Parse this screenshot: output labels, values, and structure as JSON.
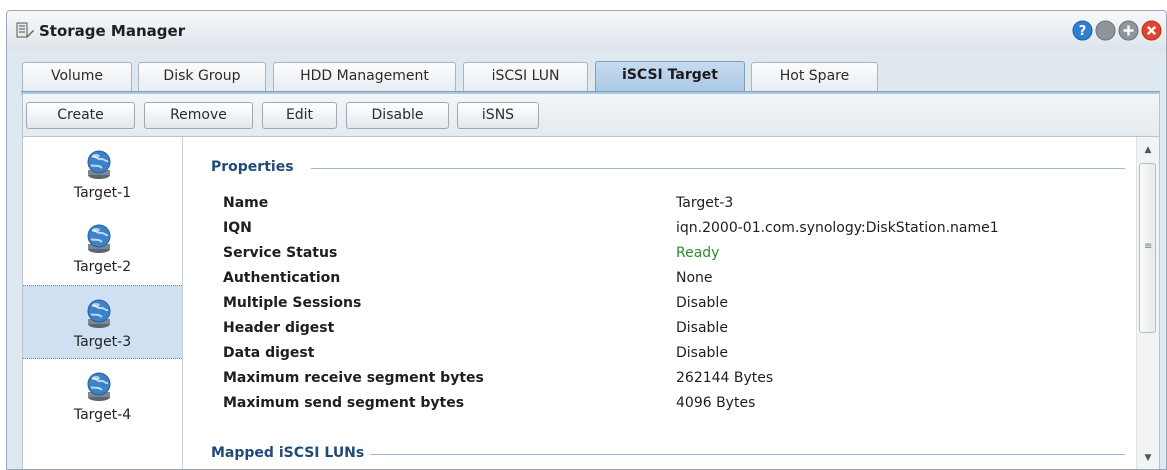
{
  "window": {
    "title": "Storage Manager",
    "app_icon": "storage-manager-icon",
    "controls": [
      "help-icon",
      "minimize-icon",
      "maximize-icon",
      "close-icon"
    ]
  },
  "tabs": [
    {
      "label": "Volume",
      "active": false
    },
    {
      "label": "Disk Group",
      "active": false
    },
    {
      "label": "HDD Management",
      "active": false
    },
    {
      "label": "iSCSI LUN",
      "active": false
    },
    {
      "label": "iSCSI Target",
      "active": true
    },
    {
      "label": "Hot Spare",
      "active": false
    }
  ],
  "toolbar": {
    "create": "Create",
    "remove": "Remove",
    "edit": "Edit",
    "disable": "Disable",
    "isns": "iSNS"
  },
  "targets": [
    {
      "label": "Target-1",
      "icon": "globe-disk-icon",
      "selected": false
    },
    {
      "label": "Target-2",
      "icon": "globe-disk-icon",
      "selected": false
    },
    {
      "label": "Target-3",
      "icon": "globe-disk-icon",
      "selected": true
    },
    {
      "label": "Target-4",
      "icon": "globe-disk-icon",
      "selected": false
    }
  ],
  "properties": {
    "heading": "Properties",
    "rows": [
      {
        "label": "Name",
        "value": "Target-3"
      },
      {
        "label": "IQN",
        "value": "iqn.2000-01.com.synology:DiskStation.name1"
      },
      {
        "label": "Service Status",
        "value": "Ready"
      },
      {
        "label": "Authentication",
        "value": "None"
      },
      {
        "label": "Multiple Sessions",
        "value": "Disable"
      },
      {
        "label": "Header digest",
        "value": "Disable"
      },
      {
        "label": "Data digest",
        "value": "Disable"
      },
      {
        "label": "Maximum receive segment bytes",
        "value": "262144 Bytes"
      },
      {
        "label": "Maximum send segment bytes",
        "value": "4096 Bytes"
      }
    ]
  },
  "mapped": {
    "heading": "Mapped iSCSI LUNs"
  },
  "colors": {
    "status_ready": "#2e8b2e",
    "accent": "#224a78",
    "selection": "#cfe0f3"
  }
}
